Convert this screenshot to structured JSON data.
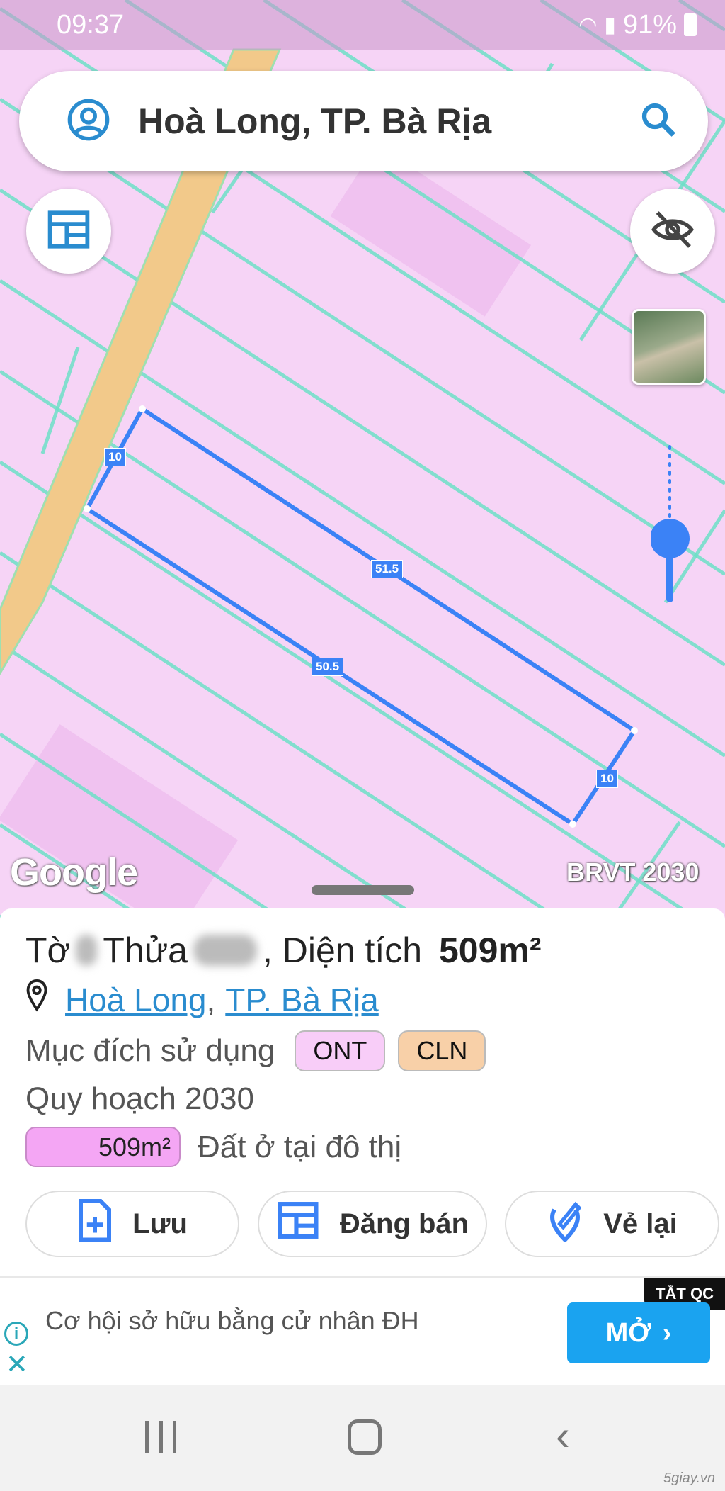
{
  "status_bar": {
    "time": "09:37",
    "battery": "91%"
  },
  "search": {
    "value": "Hoà Long, TP. Bà Rịa"
  },
  "map": {
    "edge_labels": [
      "10",
      "51.5",
      "50.5",
      "10"
    ],
    "attribution": "Google",
    "layer_label": "BRVT 2030",
    "colors": {
      "land": "#f6d4f6",
      "road": "#f2c98a",
      "parcel_line": "#6ee0c8",
      "selection": "#3b82f6"
    }
  },
  "parcel": {
    "to_label": "Tờ",
    "thua_label": "Thửa",
    "area_text": ", Diện tích ",
    "area_value": "509m²",
    "location_ward": "Hoà Long",
    "location_sep": ",",
    "location_city": "TP. Bà Rịa",
    "purpose_label": "Mục đích sử dụng",
    "purpose_tags": [
      {
        "code": "ONT",
        "color": "#f8cdf8"
      },
      {
        "code": "CLN",
        "color": "#f8d0a8"
      }
    ],
    "planning_label": "Quy hoạch 2030",
    "planning_area": "509m²",
    "planning_type": "Đất ở tại đô thị",
    "planning_color": "#f4a6f4"
  },
  "actions": {
    "save": "Lưu",
    "post": "Đăng bán",
    "redraw": "Vẻ lại"
  },
  "ad": {
    "text": "Cơ hội sở hữu bằng cử nhân ĐH",
    "open": "MỞ",
    "close_ads": "TẮT QC"
  },
  "watermark": "5giay.vn"
}
